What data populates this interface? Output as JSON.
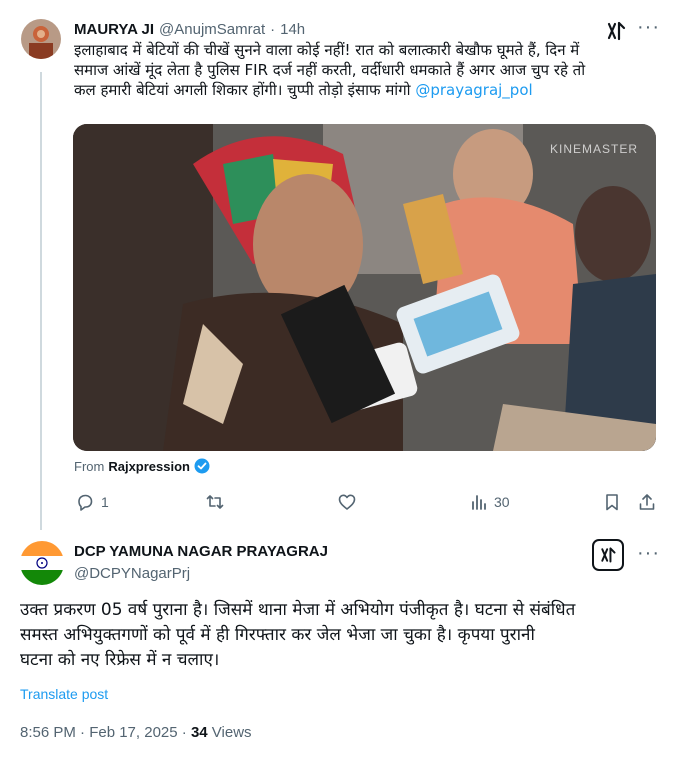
{
  "tweet1": {
    "name": "MAURYA JI",
    "handle": "@AnujmSamrat",
    "sep": "·",
    "time": "14h",
    "text_line1": "इलाहाबाद में बेटियों की चीखें सुनने वाला कोई नहीं! रात को बलात्कारी बेखौफ घूमते हैं, दिन में",
    "text_line2": "समाज आंखें मूंद लेता है पुलिस FIR दर्ज नहीं करती, वर्दीधारी धमकाते हैं अगर आज चुप रहे तो",
    "text_line3": "कल हमारी बेटियां अगली शिकार होंगी। चुप्पी तोड़ो इंसाफ मांगो",
    "mention": "@prayagraj_pol",
    "media_watermark": "KINEMASTER",
    "from_label": "From",
    "from_source": "Rajxpression",
    "replies": "1",
    "reposts": "",
    "likes": "",
    "views": "30"
  },
  "tweet2": {
    "name": "DCP YAMUNA NAGAR PRAYAGRAJ",
    "handle": "@DCPYNagarPrj",
    "text_line1": "उक्त प्रकरण 05 वर्ष पुराना है। जिसमें थाना मेजा में अभियोग पंजीकृत है। घटना से संबंधित",
    "text_line2": "समस्त अभियुक्तगणों को पूर्व में ही गिरफ्तार कर जेल भेजा जा चुका है।  कृपया पुरानी",
    "text_line3": "घटना को नए रिफ्रेस में न चलाए।",
    "translate": "Translate post",
    "time": "8:56 PM · Feb 17, 2025 ·",
    "views_count": "34",
    "views_label": "Views"
  },
  "colors": {
    "accent": "#1d9bf0",
    "verified": "#1d9bf0",
    "muted": "#536471"
  },
  "icons": [
    "grok-icon",
    "more-icon",
    "reply-icon",
    "repost-icon",
    "like-icon",
    "views-icon",
    "bookmark-icon",
    "share-icon",
    "verified-icon"
  ]
}
